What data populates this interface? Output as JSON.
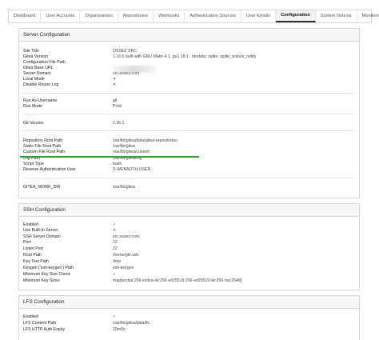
{
  "tabs": [
    "Dashboard",
    "User Accounts",
    "Organizations",
    "Repositories",
    "Webhooks",
    "Authentication Sources",
    "User Emails",
    "Configuration",
    "System Notices",
    "Monitoring"
  ],
  "active_tab": "Configuration",
  "server": {
    "title": "Server Configuration",
    "rows": [
      {
        "k": "Site Title",
        "v": "OSSEZ SRC"
      },
      {
        "k": "Gitea Version",
        "v": "1.16.6 built with GNU Make 4.1, go1.18.1 : bindata, sqlite, sqlite_unlock_notify"
      },
      {
        "k": "Configuration File Path",
        "v": ""
      },
      {
        "k": "Gitea Base URL",
        "v": ""
      },
      {
        "k": "Server Domain",
        "v": "src.ossez.com"
      },
      {
        "k": "Local Mode",
        "v": "✕"
      },
      {
        "k": "Disable Router Log",
        "v": "✕"
      },
      {
        "k": "Run As Username",
        "v": "git"
      },
      {
        "k": "Run Mode",
        "v": "Prod"
      },
      {
        "k": "Git Version",
        "v": "2.35.1"
      },
      {
        "k": "Repository Root Path",
        "v": "/var/lib/gitea/data/gitea-repositories"
      },
      {
        "k": "Static File Root Path",
        "v": "/var/lib/gitea"
      },
      {
        "k": "Custom File Root Path",
        "v": "/var/lib/gitea/custom"
      },
      {
        "k": "Log Path",
        "v": "/var/lib/gitea/log"
      },
      {
        "k": "Script Type",
        "v": "bash"
      },
      {
        "k": "Reverse Authentication User",
        "v": "X-WEBAUTH-USER"
      },
      {
        "k": "GITEA_WORK_DIR",
        "v": "/var/lib/gitea"
      }
    ]
  },
  "ssh": {
    "title": "SSH Configuration",
    "rows": [
      {
        "k": "Enabled",
        "v": "✓"
      },
      {
        "k": "Use Built-In Server",
        "v": "✕"
      },
      {
        "k": "SSH Server Domain",
        "v": "src.ossez.com"
      },
      {
        "k": "Port",
        "v": "22"
      },
      {
        "k": "Listen Port",
        "v": "22"
      },
      {
        "k": "Root Path",
        "v": "/home/git/.ssh"
      },
      {
        "k": "Key Test Path",
        "v": "/tmp"
      },
      {
        "k": "Keygen ('ssh-keygen') Path",
        "v": "ssh-keygen"
      },
      {
        "k": "Minimum Key Size Check",
        "v": "✓"
      },
      {
        "k": "Minimum Key Sizes",
        "v": "map[ecdsa:256 ecdsa-sk:256 ed25519:256 ed25519-sk:256 rsa:2048]"
      }
    ]
  },
  "lfs": {
    "title": "LFS Configuration",
    "rows": [
      {
        "k": "Enabled",
        "v": "✓"
      },
      {
        "k": "LFS Content Path",
        "v": "/var/lib/gitea/data/lfs"
      },
      {
        "k": "LFS HTTP Auth Expiry",
        "v": "20m0s"
      }
    ]
  }
}
